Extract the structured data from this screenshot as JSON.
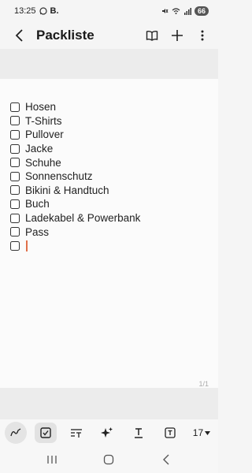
{
  "status_bar": {
    "time": "13:25",
    "app_badge": "B.",
    "battery": "66"
  },
  "header": {
    "title": "Packliste"
  },
  "checklist": {
    "items": [
      "Hosen",
      "T-Shirts",
      "Pullover",
      "Jacke",
      "Schuhe",
      "Sonnenschutz",
      "Bikini & Handtuch",
      "Buch",
      "Ladekabel & Powerbank",
      "Pass"
    ]
  },
  "page_indicator": "1/1",
  "toolbar": {
    "font_size": "17"
  },
  "icons": {
    "back": "back-arrow-icon",
    "book": "open-book-icon",
    "add": "plus-icon",
    "more": "more-vert-icon",
    "pen": "pen-icon",
    "checkbox": "checkbox-icon",
    "text_format": "text-format-icon",
    "ai": "sparkle-icon",
    "underline": "text-underline-icon",
    "textbox": "textbox-icon"
  },
  "colors": {
    "caret": "#e0704a",
    "background": "#f5f5f5"
  }
}
